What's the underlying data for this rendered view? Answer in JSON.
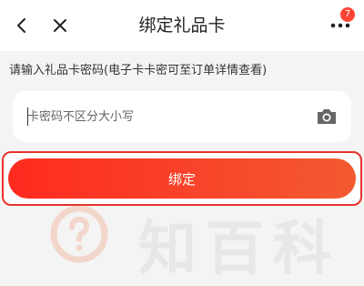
{
  "header": {
    "title": "绑定礼品卡",
    "back_icon": "chevron-left-icon",
    "close_icon": "close-icon",
    "more_icon": "more-dots-icon",
    "badge_count": "7"
  },
  "hint_text": "请输入礼品卡密码(电子卡卡密可至订单详情查看)",
  "card_input": {
    "placeholder": "卡密码不区分大小写",
    "value": "",
    "camera_icon": "camera-icon"
  },
  "bind_button": {
    "label": "绑定"
  },
  "watermark": {
    "text": "知百科",
    "logo_icon": "question-logo-icon"
  },
  "colors": {
    "accent": "#f8442a",
    "highlight_border": "#e8322c",
    "badge": "#ff4433",
    "page_background": "#f4f4f4"
  }
}
